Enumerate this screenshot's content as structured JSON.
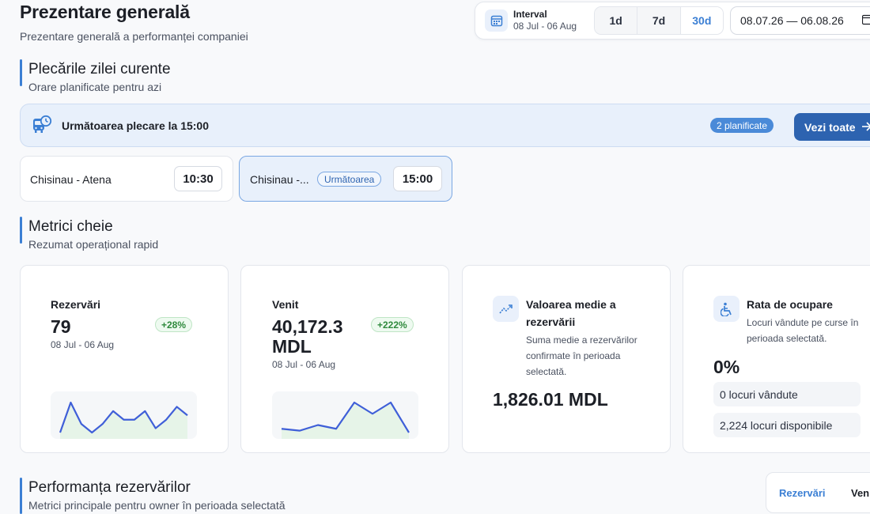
{
  "header": {
    "title": "Prezentare generală",
    "subtitle": "Prezentare generală a performanței companiei"
  },
  "interval": {
    "label": "Interval",
    "range": "08 Jul - 06 Aug",
    "options": [
      "1d",
      "7d",
      "30d"
    ],
    "selected": "30d",
    "date_value": "08.07.26 — 06.08.26"
  },
  "departures": {
    "title": "Plecările zilei curente",
    "subtitle": "Orare planificate pentru azi",
    "banner_text": "Următoarea plecare la 15:00",
    "planned_badge": "2 planificate",
    "view_all": "Vezi toate",
    "items": [
      {
        "route": "Chisinau - Atena",
        "time": "10:30"
      },
      {
        "route": "Chisinau -...",
        "badge": "Următoarea",
        "time": "15:00"
      }
    ]
  },
  "metrics": {
    "title": "Metrici cheie",
    "subtitle": "Rezumat operațional rapid",
    "bookings": {
      "label": "Rezervări",
      "value": "79",
      "trend": "+28%",
      "range": "08 Jul - 06 Aug",
      "spark": [
        2,
        9,
        4,
        2,
        4,
        7,
        5,
        5,
        7,
        3,
        5,
        8,
        6
      ]
    },
    "revenue": {
      "label": "Venit",
      "value": "40,172.3 MDL",
      "trend": "+222%",
      "range": "08 Jul - 06 Aug",
      "spark": [
        2,
        1.5,
        3,
        2,
        9,
        6,
        9,
        1
      ]
    },
    "avg_booking": {
      "title": "Valoarea medie a rezervării",
      "desc": "Suma medie a rezervărilor confirmate în perioada selectată.",
      "value": "1,826.01 MDL"
    },
    "occupancy": {
      "title": "Rata de ocupare",
      "desc": "Locuri vândute pe curse în perioada selectată.",
      "value": "0%",
      "sold": "0 locuri vândute",
      "available": "2,224 locuri disponibile"
    }
  },
  "performance": {
    "title": "Performanța rezervărilor",
    "subtitle": "Metrici principale pentru owner în perioada selectată",
    "tabs": [
      "Rezervări",
      "Venit"
    ]
  },
  "colors": {
    "accent": "#3b7fd4",
    "primary_button": "#2d63b0",
    "trend_green": "#2f8a3d"
  }
}
